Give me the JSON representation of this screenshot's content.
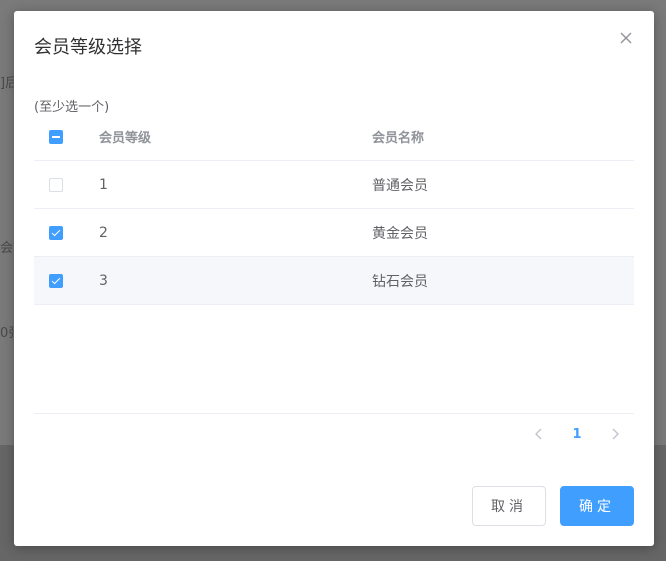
{
  "background": {
    "fragments": [
      "]后",
      "会",
      "0张"
    ]
  },
  "dialog": {
    "title": "会员等级选择",
    "close_icon": "close-icon",
    "hint": "(至少选一个)",
    "table": {
      "columns": {
        "level": "会员等级",
        "name": "会员名称"
      },
      "header_checkbox_state": "indeterminate",
      "rows": [
        {
          "level": "1",
          "name": "普通会员",
          "checked": false
        },
        {
          "level": "2",
          "name": "黄金会员",
          "checked": true
        },
        {
          "level": "3",
          "name": "钻石会员",
          "checked": true
        }
      ]
    },
    "pagination": {
      "current_page": "1",
      "prev_icon": "chevron-left-icon",
      "next_icon": "chevron-right-icon"
    },
    "buttons": {
      "cancel": "取消",
      "confirm": "确定"
    }
  },
  "colors": {
    "primary": "#409eff",
    "border": "#ebeef5",
    "overlay": "#7a7a7a"
  }
}
